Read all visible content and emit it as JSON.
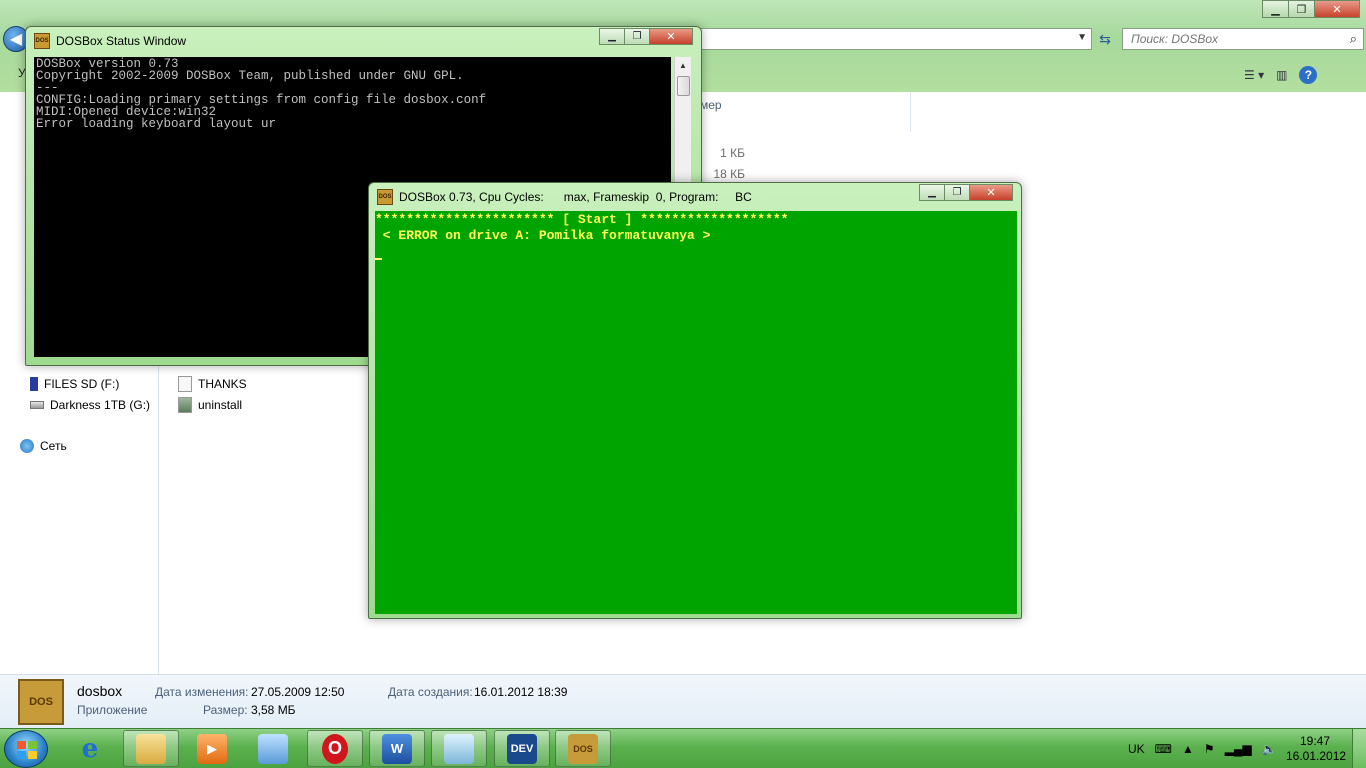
{
  "explorer": {
    "toolbar_left": "У",
    "search_placeholder": "Поиск: DOSBox",
    "column_partial": "мер",
    "sizes": [
      "1 КБ",
      "18 КБ"
    ],
    "nav": {
      "items": [
        {
          "label": "FILES SD (F:)",
          "icon": "sd-card-icon"
        },
        {
          "label": "Darkness 1TB (G:)",
          "icon": "hard-drive-icon"
        },
        {
          "label": "Сеть",
          "icon": "network-icon"
        }
      ]
    },
    "files": [
      {
        "label": "THANKS",
        "icon": "text-file-icon"
      },
      {
        "label": "uninstall",
        "icon": "installer-icon"
      }
    ],
    "details": {
      "name": "dosbox",
      "type": "Приложение",
      "modified_label": "Дата изменения:",
      "modified_value": "27.05.2009 12:50",
      "size_label": "Размер:",
      "size_value": "3,58 МБ",
      "created_label": "Дата создания:",
      "created_value": "16.01.2012 18:39"
    }
  },
  "status_window": {
    "title": "DOSBox Status Window",
    "console_lines": [
      "DOSBox version 0.73",
      "Copyright 2002-2009 DOSBox Team, published under GNU GPL.",
      "---",
      "CONFIG:Loading primary settings from config file dosbox.conf",
      "MIDI:Opened device:win32",
      "Error loading keyboard layout ur"
    ]
  },
  "dosbox_window": {
    "title": "DOSBox 0.73, Cpu Cycles:      max, Frameskip  0, Program:     BC",
    "screen_lines": [
      "*********************** [ Start ] *******************",
      " < ERROR on drive A: Pomilka formatuvanya >"
    ],
    "screen_bg": "#00a400",
    "screen_fg": "#ffff55"
  },
  "taskbar": {
    "apps": [
      {
        "name": "ie",
        "icon": "internet-explorer-icon"
      },
      {
        "name": "explorer",
        "icon": "folder-explorer-icon"
      },
      {
        "name": "media",
        "icon": "media-player-icon"
      },
      {
        "name": "paint",
        "icon": "paint-icon"
      },
      {
        "name": "opera",
        "icon": "opera-icon"
      },
      {
        "name": "word",
        "icon": "word-icon"
      },
      {
        "name": "notes",
        "icon": "notes-icon"
      },
      {
        "name": "dev",
        "icon": "dev-cpp-icon",
        "label": "DEV"
      },
      {
        "name": "dosbox",
        "icon": "dosbox-icon"
      }
    ],
    "lang": "UK",
    "time": "19:47",
    "date": "16.01.2012"
  }
}
